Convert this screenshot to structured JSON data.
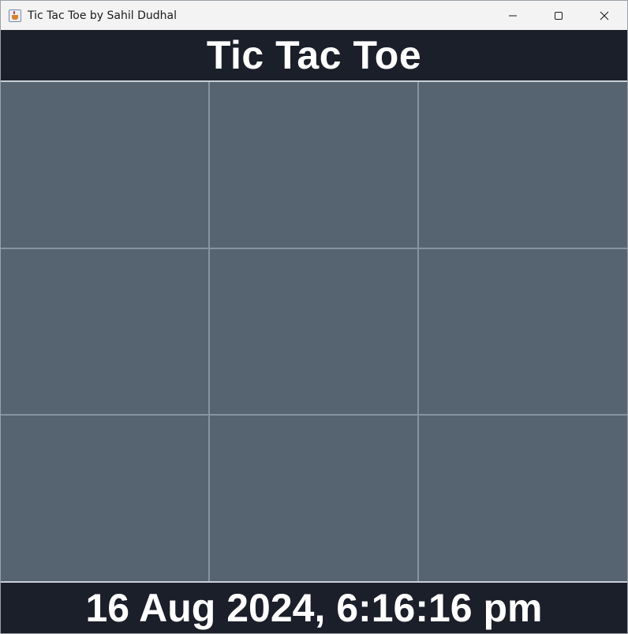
{
  "window": {
    "title": "Tic Tac Toe by Sahil Dudhal",
    "controls": {
      "minimize_icon": "minimize-icon",
      "maximize_icon": "maximize-icon",
      "close_icon": "close-icon"
    }
  },
  "header": {
    "title": "Tic Tac Toe"
  },
  "board": {
    "cells": [
      [
        "",
        "",
        ""
      ],
      [
        "",
        "",
        ""
      ],
      [
        "",
        "",
        ""
      ]
    ]
  },
  "footer": {
    "datetime": "16 Aug 2024, 6:16:16 pm"
  },
  "colors": {
    "panel": "#1b1f2a",
    "cell": "#566472",
    "grid_line": "#8893a0",
    "text": "#ffffff"
  }
}
